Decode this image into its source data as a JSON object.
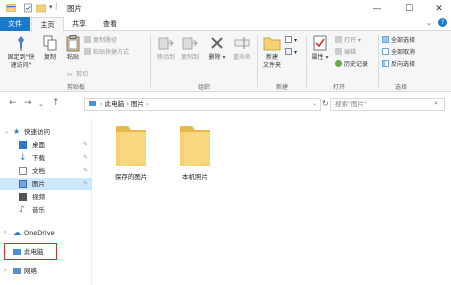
{
  "window": {
    "title": "图片",
    "minimize": "—",
    "maximize": "☐",
    "close": "✕"
  },
  "tabs": {
    "file": "文件",
    "home": "主页",
    "share": "共享",
    "view": "查看"
  },
  "ribbon": {
    "pin_quick_access": "固定到\"快\n速访问\"",
    "copy": "复制",
    "paste": "粘贴",
    "copy_path": "复制路径",
    "paste_shortcut": "粘贴快捷方式",
    "cut": "剪切",
    "group_clipboard": "剪贴板",
    "move_to": "移动到",
    "copy_to": "复制到",
    "delete": "删除",
    "rename": "重命名",
    "group_organize": "组织",
    "new_folder": "新建\n文件夹",
    "group_new": "新建",
    "properties": "属性",
    "open": "打开",
    "edit": "编辑",
    "history": "历史记录",
    "group_open": "打开",
    "select_all": "全部选择",
    "select_none": "全部取消",
    "invert_selection": "反向选择",
    "group_select": "选择"
  },
  "address": {
    "path_1": "此电脑",
    "path_2": "图片",
    "search_placeholder": "搜索\"图片\""
  },
  "navpane": {
    "quick_access": "快速访问",
    "desktop": "桌面",
    "downloads": "下载",
    "documents": "文档",
    "pictures": "图片",
    "videos": "视频",
    "music": "音乐",
    "onedrive": "OneDrive",
    "this_pc": "此电脑",
    "network": "网络"
  },
  "folders": [
    {
      "name": "保存的图片"
    },
    {
      "name": "本机照片"
    }
  ],
  "colors": {
    "accent": "#1979ca",
    "selection": "#cce8ff",
    "folder_yellow": "#f5d173",
    "highlight_box": "#d32f2f"
  }
}
